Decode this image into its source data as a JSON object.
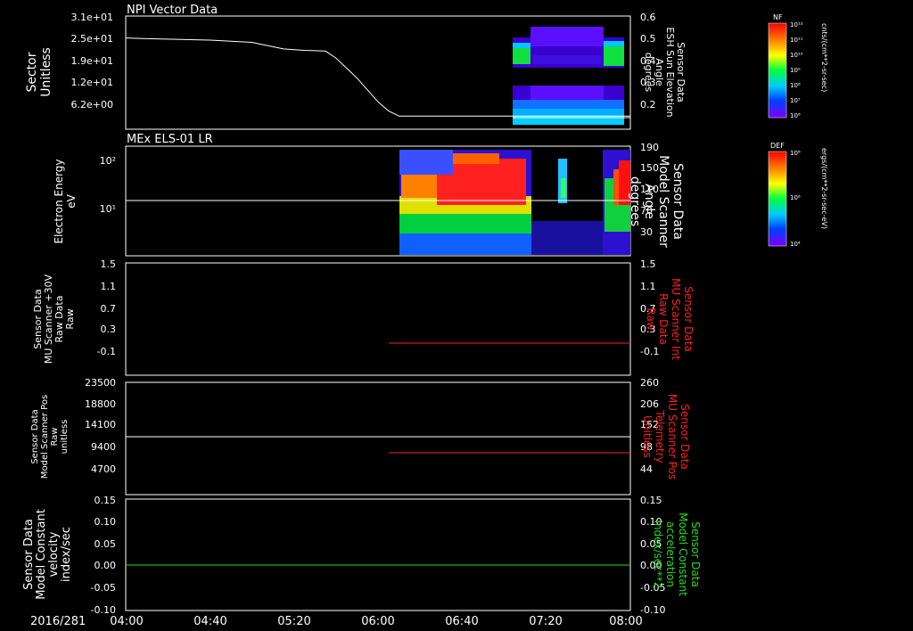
{
  "app": {
    "date_label": "2016/281"
  },
  "time_axis": {
    "ticks": [
      "04:00",
      "04:40",
      "05:20",
      "06:00",
      "06:40",
      "07:20",
      "08:00"
    ]
  },
  "panels": [
    {
      "id": "npi",
      "title": "NPI Vector Data",
      "left_label": [
        "Sector",
        "Unitless"
      ],
      "left_ticks": [
        "3.1e+01",
        "2.5e+01",
        "1.9e+01",
        "1.2e+01",
        "6.2e+00"
      ],
      "right_ticks": [
        "0.6",
        "0.5",
        "0.4",
        "0.3",
        "0.2"
      ],
      "right_label": [
        "Sensor Data",
        "ESH Sun Elevation",
        "Angle",
        "degrees"
      ],
      "colorbar": {
        "title": "NF",
        "ticks": [
          "10¹²",
          "10¹¹",
          "10¹⁰",
          "10⁹",
          "10⁸",
          "10⁷",
          "10⁶"
        ],
        "units": "cnts/(cm**2-sr-sec)"
      }
    },
    {
      "id": "els",
      "title": "MEx ELS-01 LR",
      "left_label": [
        "Electron Energy",
        "eV"
      ],
      "left_ticks": [
        "10²",
        "10¹"
      ],
      "right_ticks": [
        "190",
        "150",
        "110",
        "70",
        "30"
      ],
      "right_label": [
        "Sensor Data",
        "Model Scanner",
        "Angle",
        "degrees"
      ],
      "colorbar": {
        "title": "DEF",
        "ticks": [
          "10⁸",
          "10⁶",
          "10⁴"
        ],
        "units": "ergs/(cm**2-sr-sec-eV)"
      }
    },
    {
      "id": "mu30",
      "left_label": [
        "Sensor Data",
        "MU Scanner +30V",
        "Raw Data",
        "Raw"
      ],
      "left_ticks": [
        "1.5",
        "1.1",
        "0.7",
        "0.3",
        "-0.1"
      ],
      "right_ticks": [
        "1.5",
        "1.1",
        "0.7",
        "0.3",
        "-0.1"
      ],
      "right_label": [
        "Sensor Data",
        "MU Scanner Int",
        "Raw Data",
        "Raw"
      ]
    },
    {
      "id": "pos",
      "left_label": [
        "Sensor Data",
        "Model Scanner Pos",
        "Raw",
        "unitless"
      ],
      "left_ticks": [
        "23500",
        "18800",
        "14100",
        "9400",
        "4700"
      ],
      "right_ticks": [
        "260",
        "206",
        "152",
        "98",
        "44"
      ],
      "right_label": [
        "Sensor Data",
        "MU Scanner Pos",
        "Telemetry",
        "Unitless"
      ]
    },
    {
      "id": "const",
      "left_label": [
        "Sensor Data",
        "Model Constant",
        "velocity",
        "index/sec"
      ],
      "left_ticks": [
        "0.15",
        "0.10",
        "0.05",
        "0.00",
        "-0.05",
        "-0.10"
      ],
      "right_ticks": [
        "0.15",
        "0.10",
        "0.05",
        "0.00",
        "-0.05",
        "-0.10"
      ],
      "right_label": [
        "Sensor Data",
        "Model Constant",
        "acceleration",
        "index/sec**2"
      ]
    }
  ],
  "colors": {
    "axis": "#ffffff",
    "red_series": "#ff2020",
    "green_series": "#22dd22",
    "right_label_red": "#ff2020",
    "right_label_green": "#22dd22"
  },
  "chart_data": [
    {
      "type": "line",
      "panel": "npi",
      "title": "NPI Vector Data",
      "x_unit": "minutes since 04:00",
      "xlim": [
        0,
        240
      ],
      "series": [
        {
          "values_x": [
            0,
            10,
            40,
            60,
            75,
            85,
            95,
            100,
            110,
            120,
            125,
            130,
            240
          ],
          "values_y": [
            25.0,
            24.8,
            24.4,
            23.8,
            22.0,
            21.6,
            21.4,
            19.5,
            14,
            7.5,
            5.0,
            3.6,
            3.6
          ]
        }
      ],
      "ylim": [
        0,
        31
      ]
    },
    {
      "type": "heatmap",
      "panel": "els",
      "title": "MEx ELS-01 LR",
      "xlim": [
        0,
        240
      ],
      "hline_y": 15,
      "ylabel": "Electron Energy eV"
    },
    {
      "type": "line",
      "panel": "mu30",
      "xlim": [
        0,
        240
      ],
      "ylim": [
        -0.3,
        1.5
      ],
      "series": [
        {
          "values_x": [
            124,
            240
          ],
          "values_y": [
            -0.05,
            -0.05
          ]
        }
      ]
    },
    {
      "type": "line",
      "panel": "pos",
      "xlim": [
        0,
        240
      ],
      "ylim": [
        0,
        23500
      ],
      "series": [
        {
          "values_x": [
            0,
            240
          ],
          "values_y": [
            11200,
            11200
          ]
        },
        {
          "values_x": [
            124,
            240
          ],
          "values_y": [
            8300,
            8300
          ]
        }
      ]
    },
    {
      "type": "line",
      "panel": "const",
      "xlim": [
        0,
        240
      ],
      "ylim": [
        -0.1,
        0.15
      ],
      "series": [
        {
          "values_x": [
            0,
            240
          ],
          "values_y": [
            0.0,
            0.0
          ]
        }
      ]
    }
  ]
}
